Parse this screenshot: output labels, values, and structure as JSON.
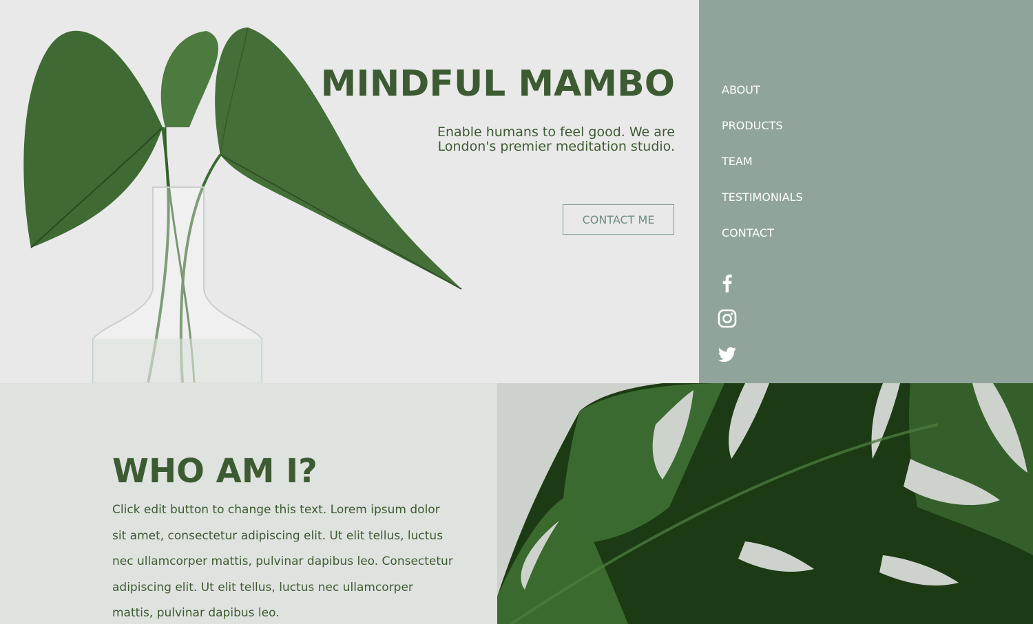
{
  "brand": {
    "title": "MINDFUL MAMBO",
    "tagline": "Enable humans to feel good. We are London's premier meditation studio."
  },
  "hero": {
    "contact_button": "CONTACT ME"
  },
  "nav": {
    "items": [
      {
        "label": "ABOUT"
      },
      {
        "label": "PRODUCTS"
      },
      {
        "label": "TEAM"
      },
      {
        "label": "TESTIMONIALS"
      },
      {
        "label": "CONTACT"
      }
    ],
    "social": [
      "facebook-icon",
      "instagram-icon",
      "twitter-icon"
    ]
  },
  "about": {
    "heading": "WHO AM I?",
    "body": "Click edit button to change this text. Lorem ipsum dolor sit amet, consectetur adipiscing elit. Ut elit tellus, luctus nec ullamcorper mattis, pulvinar dapibus leo. Consectetur adipiscing elit. Ut elit tellus, luctus nec ullamcorper mattis, pulvinar dapibus leo."
  },
  "colors": {
    "brand_green": "#3d5b32",
    "nav_panel": "#90a49b",
    "hero_bg": "#e9e9e9",
    "about_bg": "#dfe3df",
    "leaf_dark": "#1a3510"
  }
}
